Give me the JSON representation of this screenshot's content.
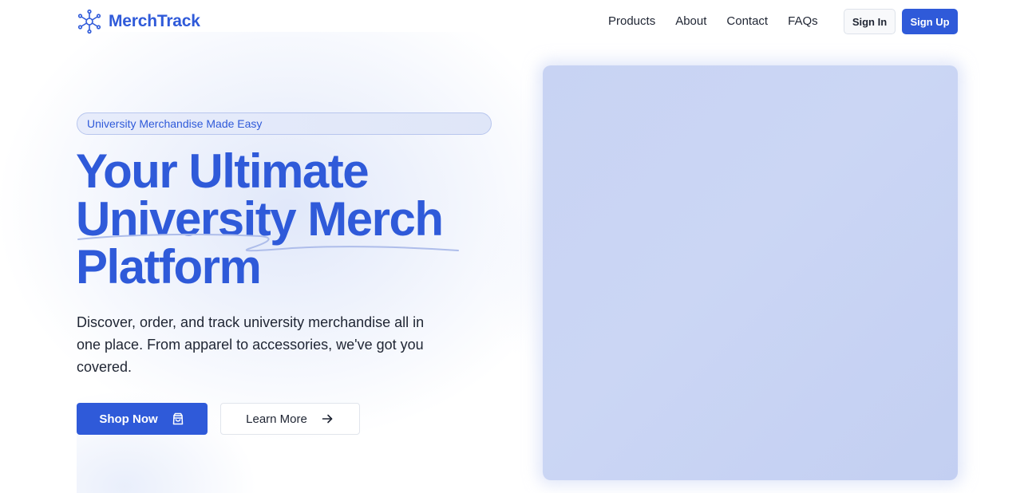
{
  "brand": {
    "name": "MerchTrack",
    "icon": "network-nodes-icon"
  },
  "nav": {
    "items": [
      "Products",
      "About",
      "Contact",
      "FAQs"
    ]
  },
  "auth": {
    "sign_in_label": "Sign In",
    "sign_up_label": "Sign Up"
  },
  "hero": {
    "badge": "University Merchandise Made Easy",
    "title_lines": [
      "Your Ultimate",
      "University Merch",
      "Platform"
    ],
    "description": "Discover, order, and track university merchandise all in one place. From apparel to accessories, we've got you covered.",
    "shop_now_label": "Shop Now",
    "shop_now_icon": "shopping-bag-icon",
    "learn_more_label": "Learn More",
    "learn_more_icon": "arrow-right-icon"
  },
  "colors": {
    "accent": "#2f5ad9",
    "text": "#1f2533",
    "hero_image_fill": "#c8d3f3"
  }
}
